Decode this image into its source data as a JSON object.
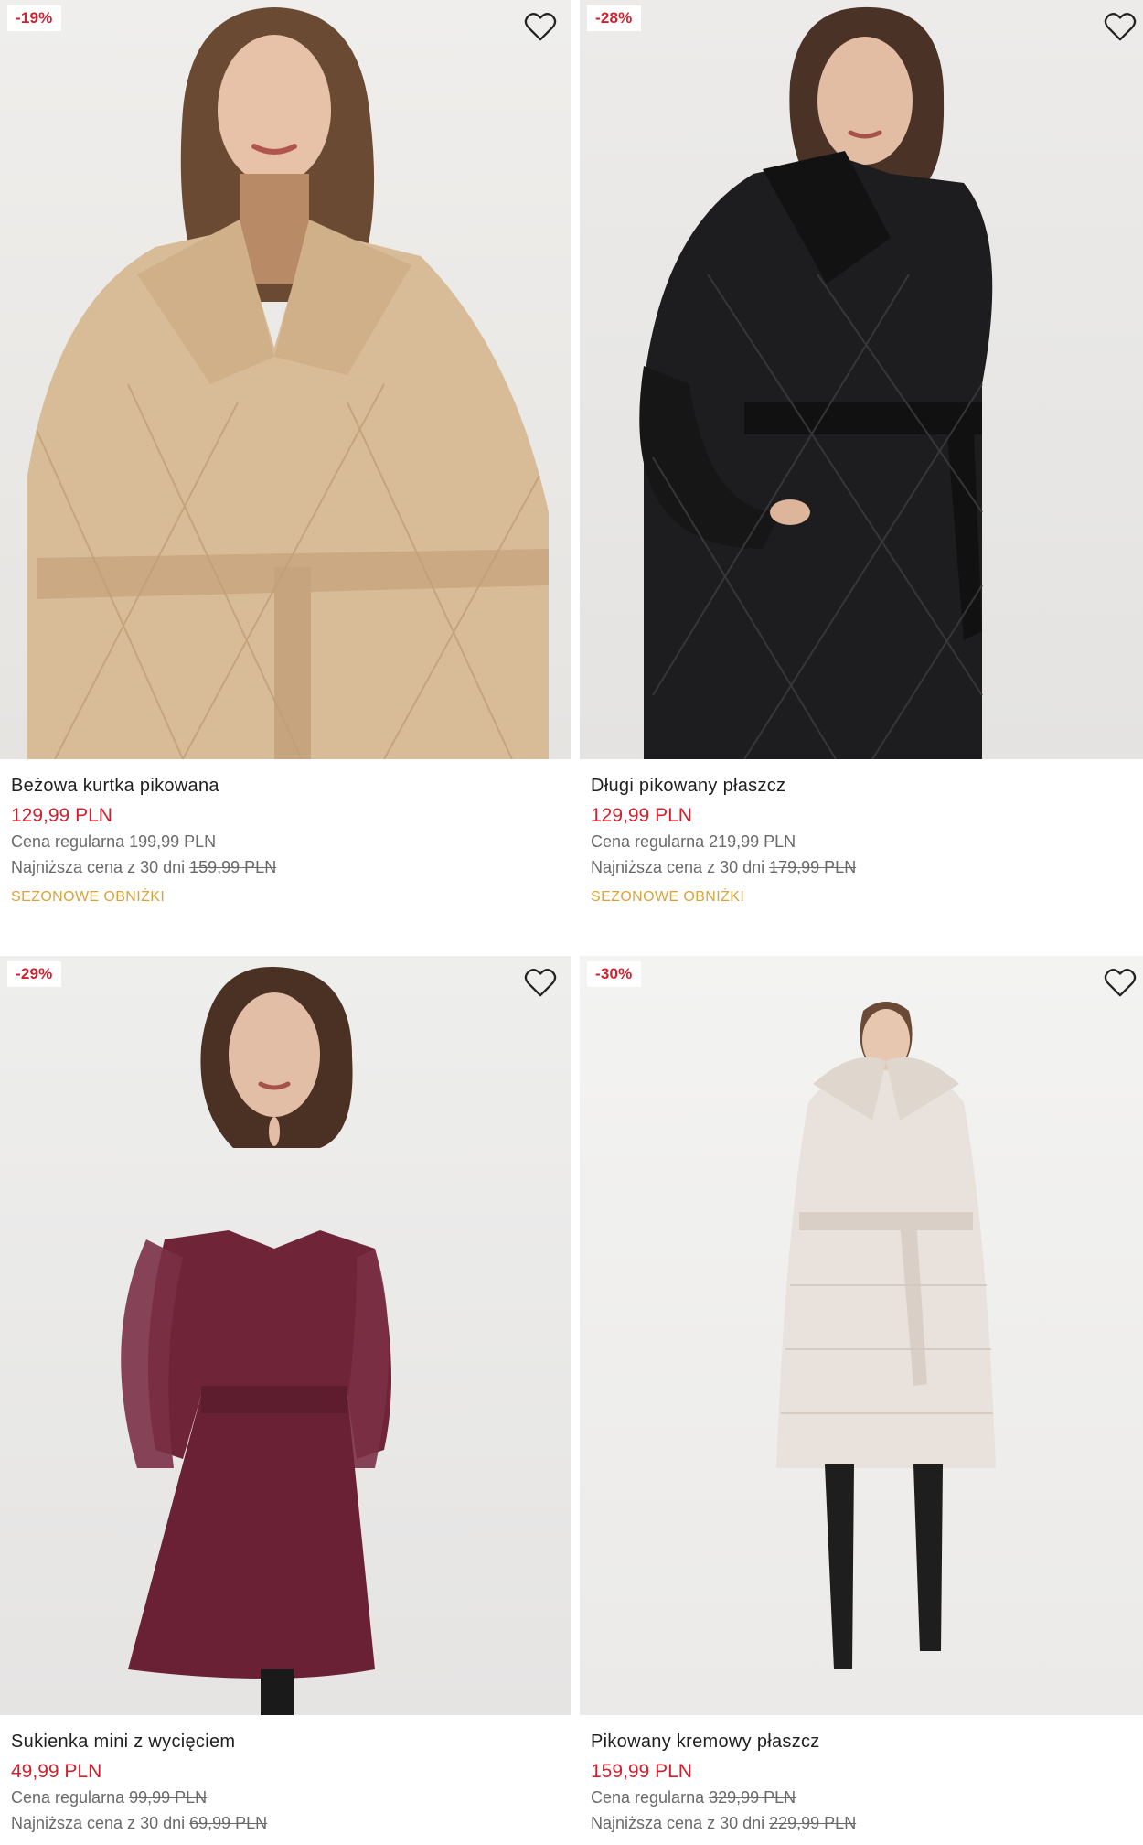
{
  "colors": {
    "sale_red": "#d2202f",
    "promo_gold": "#d9a33a",
    "muted_text": "#6a6a6a"
  },
  "products": [
    {
      "badge": "-19%",
      "name": "Beżowa kurtka pikowana",
      "price": "129,99 PLN",
      "regular_label": "Cena regularna",
      "regular_price": "199,99 PLN",
      "lowest_label": "Najniższa cena z 30 dni",
      "lowest_price": "159,99 PLN",
      "promo": "SEZONOWE OBNIŻKI",
      "wishlist_icon": "heart-icon"
    },
    {
      "badge": "-28%",
      "name": "Długi pikowany płaszcz",
      "price": "129,99 PLN",
      "regular_label": "Cena regularna",
      "regular_price": "219,99 PLN",
      "lowest_label": "Najniższa cena z 30 dni",
      "lowest_price": "179,99 PLN",
      "promo": "SEZONOWE OBNIŻKI",
      "wishlist_icon": "heart-icon"
    },
    {
      "badge": "-29%",
      "name": "Sukienka mini z wycięciem",
      "price": "49,99 PLN",
      "regular_label": "Cena regularna",
      "regular_price": "99,99 PLN",
      "lowest_label": "Najniższa cena z 30 dni",
      "lowest_price": "69,99 PLN",
      "wishlist_icon": "heart-icon"
    },
    {
      "badge": "-30%",
      "name": "Pikowany kremowy płaszcz",
      "price": "159,99 PLN",
      "regular_label": "Cena regularna",
      "regular_price": "329,99 PLN",
      "lowest_label": "Najniższa cena z 30 dni",
      "lowest_price": "229,99 PLN",
      "wishlist_icon": "heart-icon"
    }
  ]
}
